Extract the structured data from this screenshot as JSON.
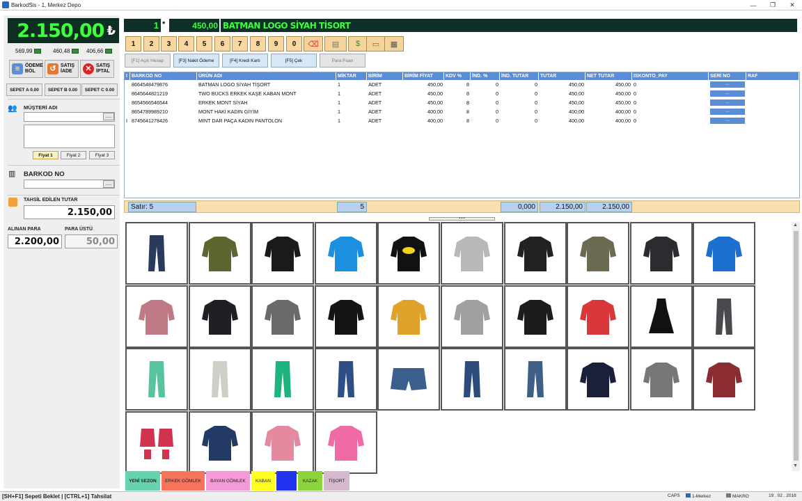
{
  "window": {
    "title": "BarkodSis - 1, Merkez Depo",
    "min": "—",
    "max": "❐",
    "close": "✕"
  },
  "totals": {
    "grand": "2.150,00",
    "currency": "₺",
    "sub1": "569,99",
    "sub2": "460,48",
    "sub3": "406,66"
  },
  "actions": {
    "split": "ÖDEME BÖL",
    "return": "SATIŞ İADE",
    "cancel": "SATIŞ İPTAL"
  },
  "baskets": [
    "SEPET A 0.00",
    "SEPET B 0.00",
    "SEPET C 0.00"
  ],
  "customer": {
    "label": "MÜŞTERİ ADI",
    "value": "",
    "dots": "....."
  },
  "price_levels": [
    "Fiyat 1",
    "Fiyat 2",
    "Fiyat 3"
  ],
  "barcode": {
    "label": "BARKOD NO",
    "value": "",
    "dots": "....."
  },
  "collected": {
    "label": "TAHSİL EDİLEN TUTAR",
    "value": "2.150,00"
  },
  "received": {
    "label": "ALINAN PARA",
    "value": "2.200,00"
  },
  "change": {
    "label": "PARA ÜSTÜ",
    "value": "50,00"
  },
  "current_item": {
    "qty": "1",
    "mult": "*",
    "price": "450,00",
    "name": "BATMAN LOGO SİYAH TİSORT"
  },
  "numpad": [
    "1",
    "2",
    "3",
    "4",
    "5",
    "6",
    "7",
    "8",
    "9",
    "0"
  ],
  "payment_buttons": [
    {
      "label": "[F1] Açık Hesap",
      "active": false
    },
    {
      "label": "[F3] Nakit Ödeme",
      "active": true
    },
    {
      "label": "[F4] Kredi Kartı",
      "active": false
    },
    {
      "label": "[F5] Çek",
      "active": false
    },
    {
      "label": "Para Puan",
      "active": false
    }
  ],
  "table": {
    "headers": [
      "BARKOD NO",
      "ÜRÜN ADI",
      "MİKTAR",
      "BİRİM",
      "BİRİM FİYAT",
      "KDV %",
      "İND. %",
      "İND. TUTAR",
      "TUTAR",
      "NET TUTAR",
      "ISKONTO_PAY",
      "SERİ NO",
      "RAF"
    ],
    "rows": [
      [
        "8664548479876",
        "BATMAN LOGO SİYAH TİŞORT",
        "1",
        "ADET",
        "450,00",
        "8",
        "0",
        "0",
        "450,00",
        "450,00",
        "0",
        "..."
      ],
      [
        "8645644821219",
        "TWO BUCKS ERKEK KAŞE KABAN MONT",
        "1",
        "ADET",
        "450,00",
        "8",
        "0",
        "0",
        "450,00",
        "450,00",
        "0",
        "..."
      ],
      [
        "8654566546544",
        "ERKEK MONT SİYAH",
        "1",
        "ADET",
        "450,00",
        "8",
        "0",
        "0",
        "450,00",
        "450,00",
        "0",
        "..."
      ],
      [
        "8654789989210",
        "MONT HAKİ KADIN GİYİM",
        "1",
        "ADET",
        "400,00",
        "8",
        "0",
        "0",
        "400,00",
        "400,00",
        "0",
        "..."
      ],
      [
        "8745641278426",
        "MİNT DAR PAÇA KADIN PANTOLON",
        "1",
        "ADET",
        "400,00",
        "8",
        "0",
        "0",
        "400,00",
        "400,00",
        "0",
        "..."
      ]
    ]
  },
  "summary": {
    "rows": "Satır: 5",
    "qty": "5",
    "discount": "0,000",
    "total": "2.150,00",
    "net": "2.150,00"
  },
  "categories": [
    {
      "label": "YENİ SEZON",
      "color": "#66d3b0"
    },
    {
      "label": "ERKEK GÖMLEK",
      "color": "#f7735a"
    },
    {
      "label": "BAYAN GÖMLEK",
      "color": "#f59ad8"
    },
    {
      "label": "KABAN",
      "color": "#ffff22"
    },
    {
      "label": "",
      "color": "#2233ee"
    },
    {
      "label": "KAZAK",
      "color": "#8cd43c"
    },
    {
      "label": "TİŞORT",
      "color": "#d7b9cf"
    }
  ],
  "products": [
    {
      "icon": "jeans-icon",
      "color": "#2a3a5a"
    },
    {
      "icon": "parka-icon",
      "color": "#5d6630"
    },
    {
      "icon": "puffer-jacket-icon",
      "color": "#1a1a1a"
    },
    {
      "icon": "polo-icon",
      "color": "#1c8fe0"
    },
    {
      "icon": "batman-tshirt-icon",
      "color": "#111111"
    },
    {
      "icon": "hoodie-icon",
      "color": "#b8b8b8"
    },
    {
      "icon": "moto-jacket-icon",
      "color": "#222222"
    },
    {
      "icon": "sweater-icon",
      "color": "#6d6a52"
    },
    {
      "icon": "sport-jacket-icon",
      "color": "#2b2b30"
    },
    {
      "icon": "cycling-jacket-icon",
      "color": "#1c6fcf"
    },
    {
      "icon": "knit-sweater-icon",
      "color": "#c07a86"
    },
    {
      "icon": "kids-jacket-icon",
      "color": "#1f1f24"
    },
    {
      "icon": "coat-icon",
      "color": "#6a6a6a"
    },
    {
      "icon": "peacoat-icon",
      "color": "#151515"
    },
    {
      "icon": "yellow-puffer-icon",
      "color": "#e1a22a"
    },
    {
      "icon": "grey-polo-icon",
      "color": "#a0a0a0"
    },
    {
      "icon": "leather-jacket-icon",
      "color": "#1c1c1c"
    },
    {
      "icon": "red-sweater-icon",
      "color": "#d9383a"
    },
    {
      "icon": "dress-icon",
      "color": "#111111"
    },
    {
      "icon": "grey-jeans-icon",
      "color": "#4a4a4e"
    },
    {
      "icon": "mint-pants-icon",
      "color": "#57c3a1"
    },
    {
      "icon": "jogger-icon",
      "color": "#cfcfc8"
    },
    {
      "icon": "green-pants-icon",
      "color": "#1fb37d"
    },
    {
      "icon": "ripped-jeans-icon",
      "color": "#2e4f86"
    },
    {
      "icon": "shorts-icon",
      "color": "#3a5f8d"
    },
    {
      "icon": "skinny-jeans-icon",
      "color": "#2c4a7c"
    },
    {
      "icon": "straight-jeans-icon",
      "color": "#3e5f86"
    },
    {
      "icon": "print-tshirt-icon",
      "color": "#1a1f3a"
    },
    {
      "icon": "cardigan-icon",
      "color": "#777777"
    },
    {
      "icon": "red-hoodie-icon",
      "color": "#8a2c30"
    },
    {
      "icon": "baby-set-icon",
      "color": "#d2334f"
    },
    {
      "icon": "navy-shirt-icon",
      "color": "#233a64"
    },
    {
      "icon": "pink-shirt-icon",
      "color": "#e48aa0"
    },
    {
      "icon": "pink-polo-icon",
      "color": "#f06aa6"
    }
  ],
  "status": {
    "left": "[SH+F1] Sepeti Beklet | [CTRL+1] Tahsilat",
    "caps": "CAPS",
    "branch": "1-Merkez",
    "user": "MAKRO",
    "date": "19 . 02 . 2018"
  }
}
